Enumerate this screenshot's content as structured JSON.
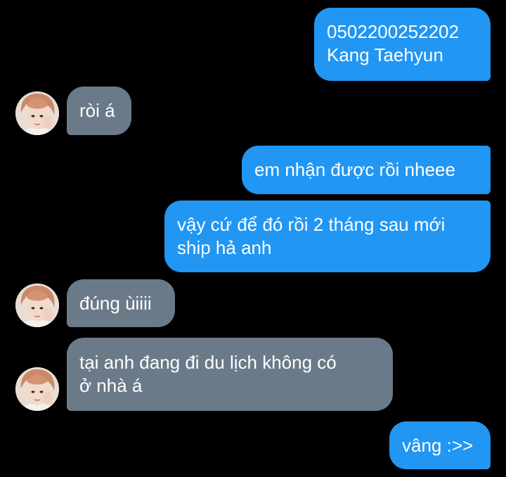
{
  "colors": {
    "background": "#000000",
    "outgoing_bubble": "#2196f3",
    "incoming_bubble": "#6a7a88",
    "text": "#ffffff"
  },
  "messages": [
    {
      "direction": "outgoing",
      "text": "0502200252202\nKang Taehyun"
    },
    {
      "direction": "incoming",
      "text": "ròi á",
      "avatar": "contact-avatar"
    },
    {
      "direction": "outgoing",
      "text": "em nhận được rồi nheee"
    },
    {
      "direction": "outgoing",
      "text": "vậy cứ để đó rồi 2 tháng sau mới\nship hả anh"
    },
    {
      "direction": "incoming",
      "text": "đúng ùiiii",
      "avatar": "contact-avatar"
    },
    {
      "direction": "incoming",
      "text": "tại anh đang đi du lịch không có\nở nhà á",
      "avatar": "contact-avatar"
    },
    {
      "direction": "outgoing",
      "text": "vâng :>>"
    }
  ]
}
